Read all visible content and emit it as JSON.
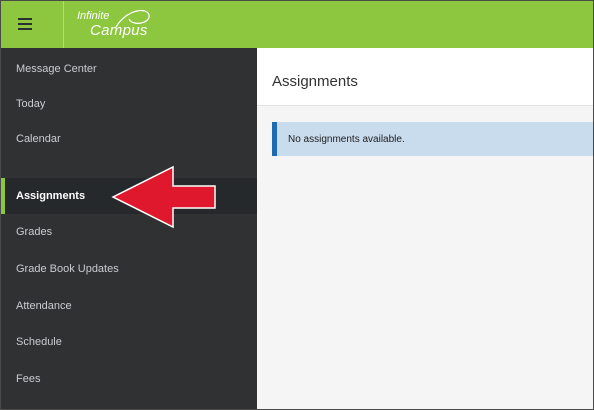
{
  "header": {
    "logo_line1": "Infinite",
    "logo_line2": "Campus",
    "brand_color": "#8dc63f",
    "menu_icon": "hamburger-menu-icon"
  },
  "sidebar": {
    "items": [
      {
        "label": "Message Center"
      },
      {
        "label": "Today"
      },
      {
        "label": "Calendar"
      },
      {
        "label": "Assignments",
        "active": true
      },
      {
        "label": "Grades"
      },
      {
        "label": "Grade Book Updates"
      },
      {
        "label": "Attendance"
      },
      {
        "label": "Schedule"
      },
      {
        "label": "Fees"
      }
    ],
    "background_color": "#2f3133",
    "active_accent": "#8dc63f"
  },
  "main": {
    "title": "Assignments",
    "alert_text": "No assignments available.",
    "alert_color": "#c9dcee",
    "alert_border_color": "#1f6bb0"
  },
  "annotation": {
    "icon": "red-arrow-left-icon",
    "color": "#e0182d"
  }
}
